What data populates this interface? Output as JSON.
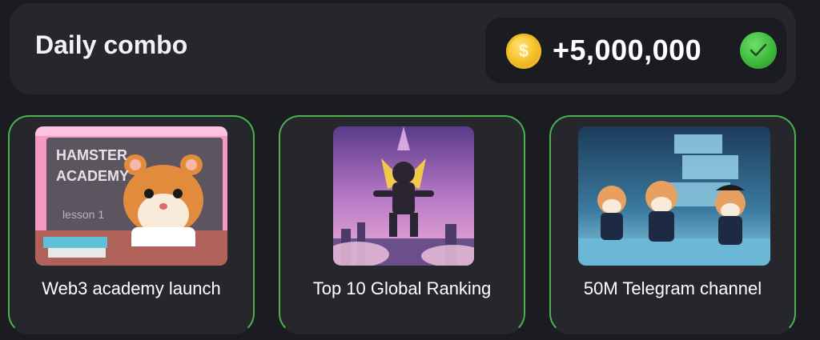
{
  "header": {
    "title": "Daily combo",
    "reward_amount": "+5,000,000",
    "coin_icon": "coin-icon",
    "coin_symbol": "$",
    "check_icon": "checkmark-icon"
  },
  "cards": [
    {
      "label": "Web3 academy launch",
      "image": "hamster-academy-illustration",
      "image_text_line1": "HAMSTER",
      "image_text_line2": "ACADEMY",
      "image_text_line3": "lesson 1"
    },
    {
      "label": "Top 10 Global Ranking",
      "image": "flying-hero-illustration"
    },
    {
      "label": "50M Telegram channel",
      "image": "pirate-hamsters-illustration"
    }
  ],
  "colors": {
    "background": "#1b1c21",
    "panel": "#26272d",
    "accent_green": "#4caf50",
    "coin_gold": "#f6c430"
  }
}
